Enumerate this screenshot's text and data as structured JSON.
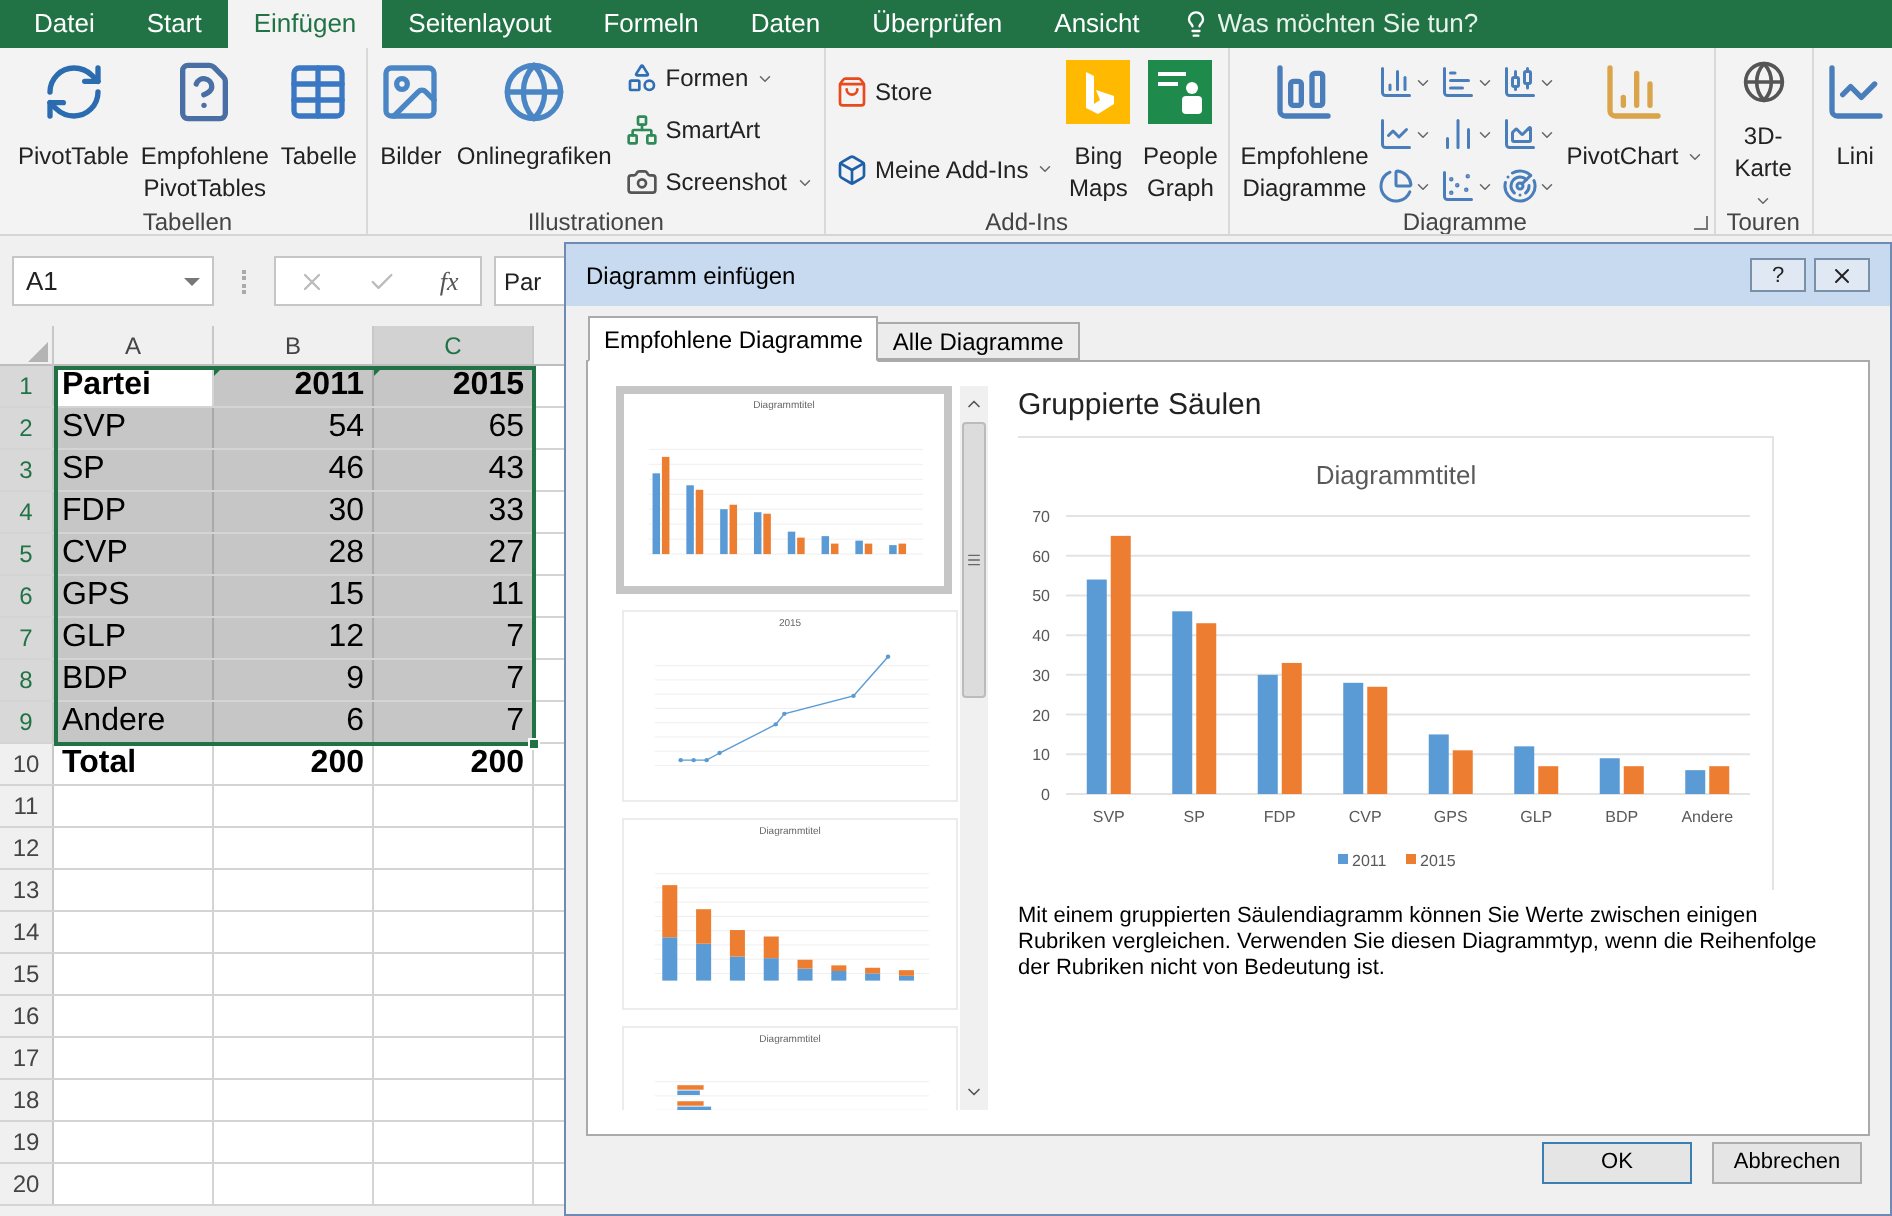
{
  "menu_tabs": [
    {
      "label": "Datei",
      "selected": false
    },
    {
      "label": "Start",
      "selected": false
    },
    {
      "label": "Einfügen",
      "selected": true
    },
    {
      "label": "Seitenlayout",
      "selected": false
    },
    {
      "label": "Formeln",
      "selected": false
    },
    {
      "label": "Daten",
      "selected": false
    },
    {
      "label": "Überprüfen",
      "selected": false
    },
    {
      "label": "Ansicht",
      "selected": false
    }
  ],
  "tell_me": {
    "placeholder": "Was möchten Sie tun?"
  },
  "ribbon": {
    "groups": [
      {
        "label": "Tabellen",
        "launcher": false,
        "items": [
          {
            "kind": "large",
            "label": "PivotTable",
            "dropdown": false
          },
          {
            "kind": "large",
            "label": "Empfohlene PivotTables",
            "dropdown": false
          },
          {
            "kind": "large",
            "label": "Tabelle",
            "dropdown": false
          }
        ]
      },
      {
        "label": "Illustrationen",
        "launcher": false,
        "items": [
          {
            "kind": "large",
            "label": "Bilder",
            "dropdown": false
          },
          {
            "kind": "large",
            "label": "Onlinegrafiken",
            "dropdown": false
          },
          {
            "kind": "stack",
            "entries": [
              {
                "label": "Formen",
                "dropdown": true
              },
              {
                "label": "SmartArt",
                "dropdown": false
              },
              {
                "label": "Screenshot",
                "dropdown": true
              }
            ]
          }
        ]
      },
      {
        "label": "Add-Ins",
        "launcher": false,
        "items": [
          {
            "kind": "stack",
            "entries": [
              {
                "label": "Store",
                "dropdown": false
              },
              {
                "label": "Meine Add-Ins",
                "dropdown": true
              }
            ]
          },
          {
            "kind": "large",
            "label": "Bing Maps",
            "dropdown": false
          },
          {
            "kind": "large",
            "label": "People Graph",
            "dropdown": false
          }
        ]
      },
      {
        "label": "Diagramme",
        "launcher": true,
        "items": [
          {
            "kind": "large",
            "label": "Empfohlene Diagramme",
            "dropdown": false
          },
          {
            "kind": "grid"
          },
          {
            "kind": "large",
            "label": "PivotChart",
            "dropdown": true
          }
        ]
      },
      {
        "label": "Touren",
        "launcher": false,
        "items": [
          {
            "kind": "large",
            "label": "3D-Karte",
            "dropdown": true
          }
        ]
      },
      {
        "launcher": false,
        "items": [
          {
            "kind": "large",
            "label": "Lini",
            "dropdown": false
          }
        ]
      }
    ]
  },
  "formula_bar": {
    "name_box": "A1",
    "function_label": "fx",
    "formula": "Par"
  },
  "sheet": {
    "columns": [
      {
        "label": "A",
        "selected": false
      },
      {
        "label": "B",
        "selected": false
      },
      {
        "label": "C",
        "selected": true
      }
    ],
    "rows": [
      {
        "header": "1",
        "selected": true,
        "bold": true,
        "cells": [
          {
            "text": "Partei",
            "active": true,
            "flagged": false
          },
          {
            "text": "2011",
            "active": false,
            "flagged": true
          },
          {
            "text": "2015",
            "active": false,
            "flagged": true
          }
        ]
      },
      {
        "header": "2",
        "selected": true,
        "bold": false,
        "cells": [
          {
            "text": "SVP",
            "active": false,
            "flagged": false
          },
          {
            "text": "54",
            "active": false,
            "flagged": false
          },
          {
            "text": "65",
            "active": false,
            "flagged": false
          }
        ]
      },
      {
        "header": "3",
        "selected": true,
        "bold": false,
        "cells": [
          {
            "text": "SP",
            "active": false,
            "flagged": false
          },
          {
            "text": "46",
            "active": false,
            "flagged": false
          },
          {
            "text": "43",
            "active": false,
            "flagged": false
          }
        ]
      },
      {
        "header": "4",
        "selected": true,
        "bold": false,
        "cells": [
          {
            "text": "FDP",
            "active": false,
            "flagged": false
          },
          {
            "text": "30",
            "active": false,
            "flagged": false
          },
          {
            "text": "33",
            "active": false,
            "flagged": false
          }
        ]
      },
      {
        "header": "5",
        "selected": true,
        "bold": false,
        "cells": [
          {
            "text": "CVP",
            "active": false,
            "flagged": false
          },
          {
            "text": "28",
            "active": false,
            "flagged": false
          },
          {
            "text": "27",
            "active": false,
            "flagged": false
          }
        ]
      },
      {
        "header": "6",
        "selected": true,
        "bold": false,
        "cells": [
          {
            "text": "GPS",
            "active": false,
            "flagged": false
          },
          {
            "text": "15",
            "active": false,
            "flagged": false
          },
          {
            "text": "11",
            "active": false,
            "flagged": false
          }
        ]
      },
      {
        "header": "7",
        "selected": true,
        "bold": false,
        "cells": [
          {
            "text": "GLP",
            "active": false,
            "flagged": false
          },
          {
            "text": "12",
            "active": false,
            "flagged": false
          },
          {
            "text": "7",
            "active": false,
            "flagged": false
          }
        ]
      },
      {
        "header": "8",
        "selected": true,
        "bold": false,
        "cells": [
          {
            "text": "BDP",
            "active": false,
            "flagged": false
          },
          {
            "text": "9",
            "active": false,
            "flagged": false
          },
          {
            "text": "7",
            "active": false,
            "flagged": false
          }
        ]
      },
      {
        "header": "9",
        "selected": true,
        "bold": false,
        "cells": [
          {
            "text": "Andere",
            "active": false,
            "flagged": false
          },
          {
            "text": "6",
            "active": false,
            "flagged": false
          },
          {
            "text": "7",
            "active": false,
            "flagged": false
          }
        ]
      },
      {
        "header": "10",
        "selected": false,
        "bold": true,
        "cells": [
          {
            "text": "Total",
            "active": false,
            "flagged": false
          },
          {
            "text": "200",
            "active": false,
            "flagged": false
          },
          {
            "text": "200",
            "active": false,
            "flagged": false
          }
        ]
      },
      {
        "header": "11",
        "selected": false
      },
      {
        "header": "12",
        "selected": false
      },
      {
        "header": "13",
        "selected": false
      },
      {
        "header": "14",
        "selected": false
      },
      {
        "header": "15",
        "selected": false
      },
      {
        "header": "16",
        "selected": false
      },
      {
        "header": "17",
        "selected": false
      },
      {
        "header": "18",
        "selected": false
      },
      {
        "header": "19",
        "selected": false
      },
      {
        "header": "20",
        "selected": false
      }
    ]
  },
  "dialog": {
    "title": "Diagramm einfügen",
    "help_button": "?",
    "tabs": [
      {
        "label": "Empfohlene Diagramme",
        "selected": true
      },
      {
        "label": "Alle Diagramme",
        "selected": false
      }
    ],
    "thumbnails": [
      {
        "kind": "clustered",
        "title": "Diagrammtitel",
        "selected": true
      },
      {
        "kind": "scatter",
        "title": "2015",
        "selected": false
      },
      {
        "kind": "stacked",
        "title": "Diagrammtitel",
        "selected": false
      },
      {
        "kind": "horizontal",
        "title": "Diagrammtitel",
        "selected": false
      }
    ],
    "preview_title": "Gruppierte Säulen",
    "chart_data": {
      "type": "bar",
      "title": "Diagrammtitel",
      "categories": [
        "SVP",
        "SP",
        "FDP",
        "CVP",
        "GPS",
        "GLP",
        "BDP",
        "Andere"
      ],
      "series": [
        {
          "name": "2011",
          "color": "#5b9bd5",
          "values": [
            54,
            46,
            30,
            28,
            15,
            12,
            9,
            6
          ]
        },
        {
          "name": "2015",
          "color": "#ed7d31",
          "values": [
            65,
            43,
            33,
            27,
            11,
            7,
            7,
            7
          ]
        }
      ],
      "ylim": [
        0,
        70
      ],
      "grid": true,
      "legend": "bottom",
      "yticks": [
        0,
        10,
        20,
        30,
        40,
        50,
        60,
        70
      ]
    },
    "description": "Mit einem gruppierten Säulendiagramm können Sie Werte zwischen einigen Rubriken vergleichen. Verwenden Sie diesen Diagrammtyp, wenn die Reihenfolge der Rubriken nicht von Bedeutung ist.",
    "buttons": [
      "OK",
      "Abbrechen"
    ]
  }
}
